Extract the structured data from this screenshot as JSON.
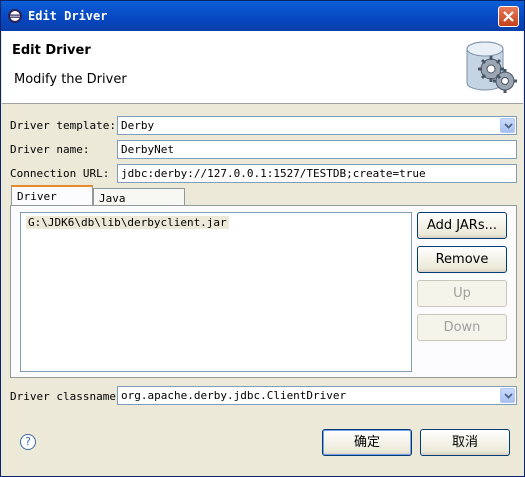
{
  "window": {
    "title": "Edit Driver",
    "close_label": "×"
  },
  "header": {
    "title": "Edit Driver",
    "description": "Modify the Driver",
    "icon": "gears-database-icon"
  },
  "form": {
    "template_label": "Driver template:",
    "template_value": "Derby",
    "name_label": "Driver name:",
    "name_value": "DerbyNet",
    "url_label": "Connection URL:",
    "url_value": "jdbc:derby://127.0.0.1:1527/TESTDB;create=true",
    "classname_label": "Driver classname:",
    "classname_value": "org.apache.derby.jdbc.ClientDriver"
  },
  "tabs": [
    {
      "label": "Driver JARs",
      "active": true
    },
    {
      "label": "Java Classpath",
      "active": false
    }
  ],
  "jars": [
    "G:\\JDK6\\db\\lib\\derbyclient.jar"
  ],
  "buttons": {
    "add": "Add JARs...",
    "remove": "Remove",
    "up": "Up",
    "down": "Down",
    "ok": "确定",
    "cancel": "取消"
  },
  "help": {
    "label": "?"
  },
  "colors": {
    "title_bar": "#0746c0",
    "dialog_bg": "#ece9d8",
    "active_tab_accent": "#e68b2c"
  }
}
